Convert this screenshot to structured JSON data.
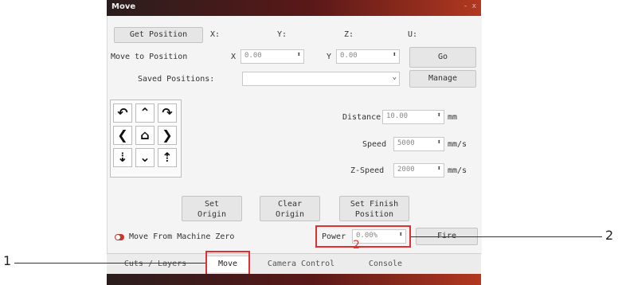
{
  "window": {
    "title": "Move",
    "controls": "- x"
  },
  "top_row": {
    "get_position_label": "Get Position",
    "x_label": "X:",
    "y_label": "Y:",
    "z_label": "Z:",
    "u_label": "U:"
  },
  "move_row": {
    "label": "Move to Position",
    "x_label": "X",
    "x_value": "0.00",
    "y_label": "Y",
    "y_value": "0.00",
    "go_label": "Go"
  },
  "saved_row": {
    "label": "Saved Positions:",
    "manage_label": "Manage"
  },
  "jog": {
    "icons": [
      "rotate-ccw-icon",
      "arrow-up-icon",
      "rotate-cw-icon",
      "arrow-left-icon",
      "home-icon",
      "arrow-right-icon",
      "z-down-icon",
      "arrow-down-icon",
      "z-up-icon"
    ],
    "glyphs": [
      "↶",
      "⌃",
      "↷",
      "❮",
      "⌂",
      "❯",
      "⇣",
      "⌄",
      "⇡"
    ]
  },
  "distance": {
    "label": "Distance",
    "value": "10.00",
    "unit": "mm"
  },
  "speed": {
    "label": "Speed",
    "value": "5000",
    "unit": "mm/s"
  },
  "z_speed": {
    "label": "Z-Speed",
    "value": "2000",
    "unit": "mm/s"
  },
  "origin_buttons": {
    "set_origin": [
      "Set",
      "Origin"
    ],
    "clear_origin": [
      "Clear",
      "Origin"
    ],
    "set_finish": [
      "Set Finish",
      "Position"
    ]
  },
  "move_from_zero": {
    "label": "Move From Machine Zero"
  },
  "power": {
    "label": "Power",
    "value": "0.00%",
    "fire_label": "Fire"
  },
  "tabs": [
    "Cuts / Layers",
    "Move",
    "Camera Control",
    "Console"
  ],
  "callouts": {
    "one": "1",
    "two": "2",
    "two_inner": "2"
  },
  "colors": {
    "highlight": "#e23030",
    "titlebar_dark": "#2a1d1d",
    "titlebar_accent": "#b23820"
  }
}
